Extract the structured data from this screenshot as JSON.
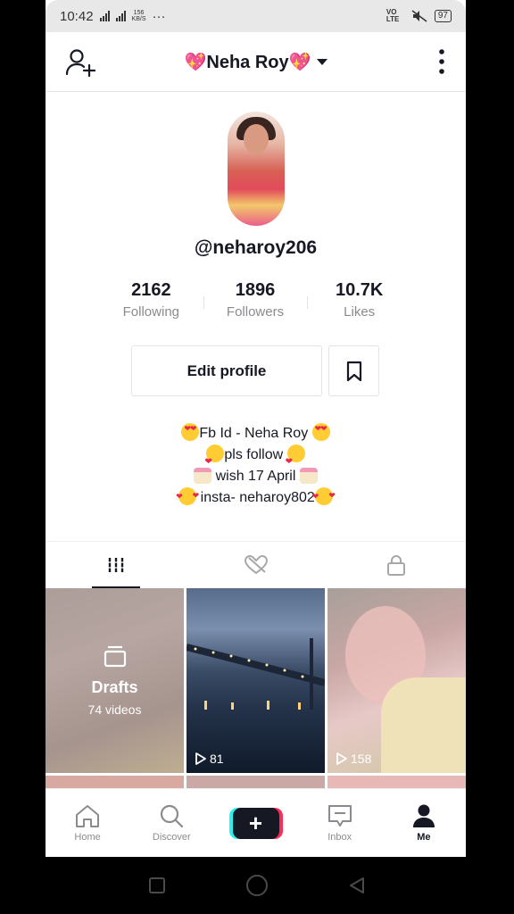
{
  "status_bar": {
    "time": "10:42",
    "network_top": "4G",
    "speed": "156",
    "speed_unit": "KB/S",
    "dots": "···",
    "volte": "VO LTE",
    "battery": "97"
  },
  "header": {
    "title": "💖Neha Roy💖"
  },
  "profile": {
    "username": "@neharoy206",
    "stats": [
      {
        "value": "2162",
        "label": "Following"
      },
      {
        "value": "1896",
        "label": "Followers"
      },
      {
        "value": "10.7K",
        "label": "Likes"
      }
    ],
    "edit_label": "Edit profile",
    "bio": [
      "Fb Id - Neha Roy",
      "pls follow",
      "wish 17 April",
      "insta- neharoy802"
    ]
  },
  "grid": {
    "drafts_label": "Drafts",
    "drafts_count": "74 videos",
    "videos": [
      {
        "plays": "81"
      },
      {
        "plays": "158"
      }
    ]
  },
  "bottom_nav": {
    "items": [
      "Home",
      "Discover",
      "",
      "Inbox",
      "Me"
    ],
    "active": "Me"
  },
  "colors": {
    "text": "#161823",
    "muted": "#8a8b91",
    "accent_cyan": "#25f4ee",
    "accent_red": "#fe2c55"
  }
}
